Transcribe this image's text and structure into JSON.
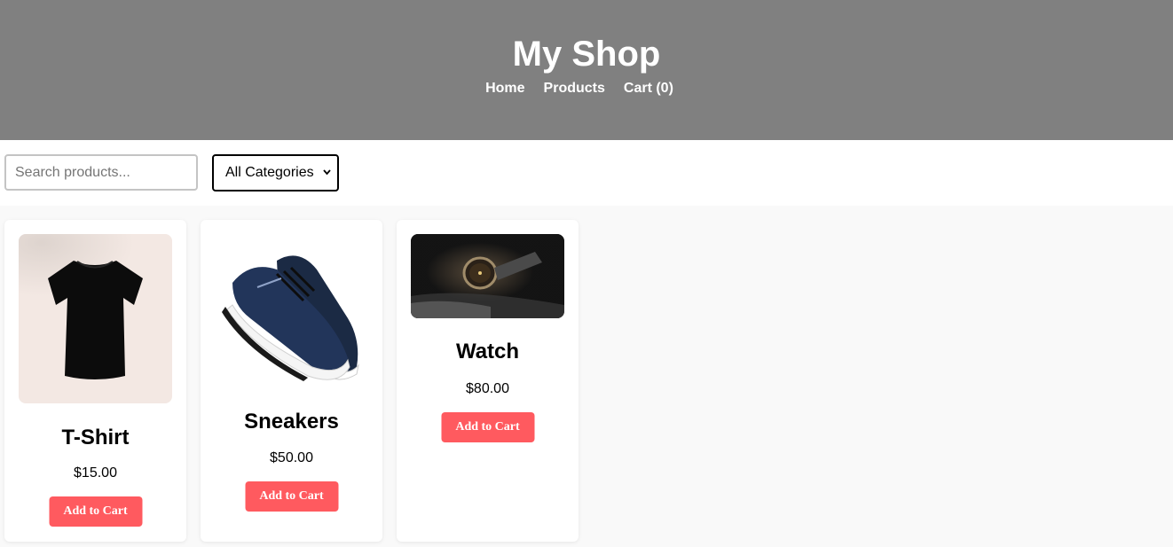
{
  "header": {
    "title": "My Shop",
    "nav": [
      "Home",
      "Products",
      "Cart (0)"
    ]
  },
  "toolbar": {
    "search_placeholder": "Search products...",
    "category_selected": "All Categories"
  },
  "products": [
    {
      "name": "T-Shirt",
      "price": "$15.00",
      "button": "Add to Cart",
      "image": "black-tshirt-photo"
    },
    {
      "name": "Sneakers",
      "price": "$50.00",
      "button": "Add to Cart",
      "image": "navy-sneakers-photo"
    },
    {
      "name": "Watch",
      "price": "$80.00",
      "button": "Add to Cart",
      "image": "watch-photo"
    }
  ],
  "colors": {
    "header_bg": "#808080",
    "accent": "#ff5a5f",
    "page_bg": "#f9f9f9"
  }
}
